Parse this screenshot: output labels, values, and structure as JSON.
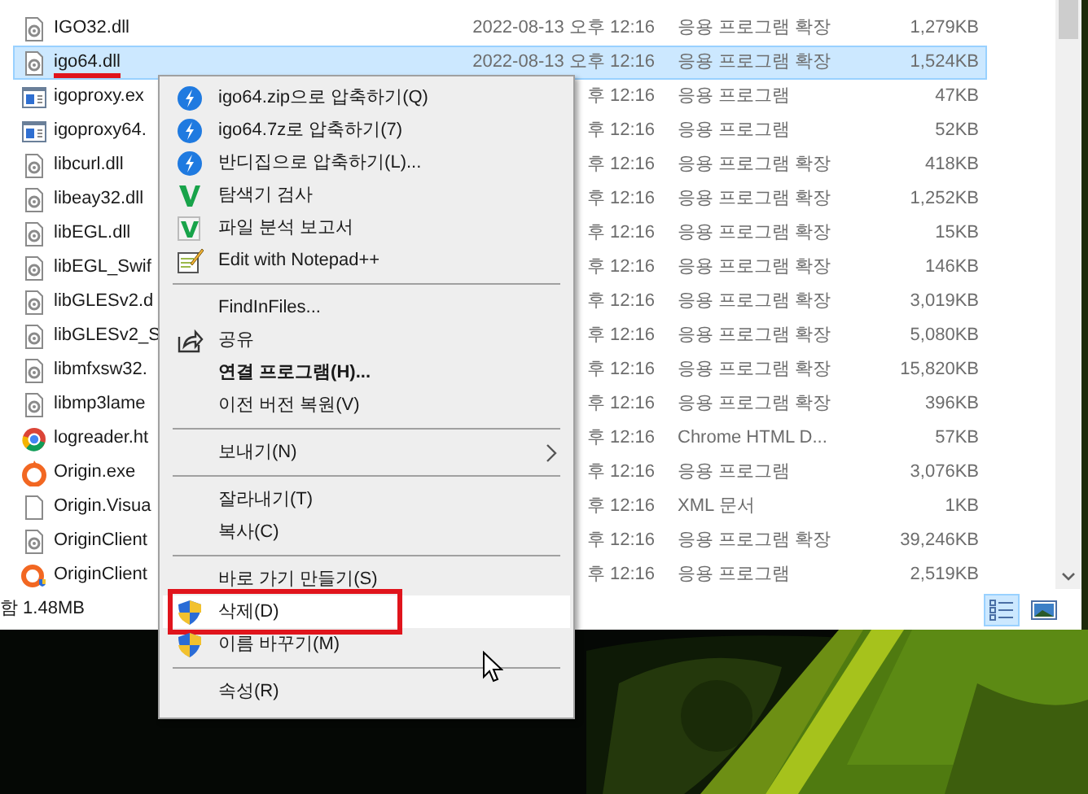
{
  "files": [
    {
      "kind": "dll",
      "name": "IGO32.dll",
      "date": "2022-08-13 오후 12:16",
      "type": "응용 프로그램 확장",
      "size": "1,279KB",
      "selected": false,
      "underlined": false
    },
    {
      "kind": "dll",
      "name": "igo64.dll",
      "date": "2022-08-13 오후 12:16",
      "type": "응용 프로그램 확장",
      "size": "1,524KB",
      "selected": true,
      "underlined": true
    },
    {
      "kind": "exe",
      "name": "igoproxy.ex",
      "date": "후 12:16",
      "type": "응용 프로그램",
      "size": "47KB",
      "selected": false,
      "underlined": false
    },
    {
      "kind": "exe",
      "name": "igoproxy64.",
      "date": "후 12:16",
      "type": "응용 프로그램",
      "size": "52KB",
      "selected": false,
      "underlined": false
    },
    {
      "kind": "dll",
      "name": "libcurl.dll",
      "date": "후 12:16",
      "type": "응용 프로그램 확장",
      "size": "418KB",
      "selected": false,
      "underlined": false
    },
    {
      "kind": "dll",
      "name": "libeay32.dll",
      "date": "후 12:16",
      "type": "응용 프로그램 확장",
      "size": "1,252KB",
      "selected": false,
      "underlined": false
    },
    {
      "kind": "dll",
      "name": "libEGL.dll",
      "date": "후 12:16",
      "type": "응용 프로그램 확장",
      "size": "15KB",
      "selected": false,
      "underlined": false
    },
    {
      "kind": "dll",
      "name": "libEGL_Swif",
      "date": "후 12:16",
      "type": "응용 프로그램 확장",
      "size": "146KB",
      "selected": false,
      "underlined": false
    },
    {
      "kind": "dll",
      "name": "libGLESv2.d",
      "date": "후 12:16",
      "type": "응용 프로그램 확장",
      "size": "3,019KB",
      "selected": false,
      "underlined": false
    },
    {
      "kind": "dll",
      "name": "libGLESv2_S",
      "date": "후 12:16",
      "type": "응용 프로그램 확장",
      "size": "5,080KB",
      "selected": false,
      "underlined": false
    },
    {
      "kind": "dll",
      "name": "libmfxsw32.",
      "date": "후 12:16",
      "type": "응용 프로그램 확장",
      "size": "15,820KB",
      "selected": false,
      "underlined": false
    },
    {
      "kind": "dll",
      "name": "libmp3lame",
      "date": "후 12:16",
      "type": "응용 프로그램 확장",
      "size": "396KB",
      "selected": false,
      "underlined": false
    },
    {
      "kind": "browser",
      "name": "logreader.ht",
      "date": "후 12:16",
      "type": "Chrome HTML D...",
      "size": "57KB",
      "selected": false,
      "underlined": false
    },
    {
      "kind": "origin",
      "name": "Origin.exe",
      "date": "후 12:16",
      "type": "응용 프로그램",
      "size": "3,076KB",
      "selected": false,
      "underlined": false
    },
    {
      "kind": "file",
      "name": "Origin.Visua",
      "date": "후 12:16",
      "type": "XML 문서",
      "size": "1KB",
      "selected": false,
      "underlined": false
    },
    {
      "kind": "dll",
      "name": "OriginClient",
      "date": "후 12:16",
      "type": "응용 프로그램 확장",
      "size": "39,246KB",
      "selected": false,
      "underlined": false
    },
    {
      "kind": "origin-shield",
      "name": "OriginClient",
      "date": "후 12:16",
      "type": "응용 프로그램",
      "size": "2,519KB",
      "selected": false,
      "underlined": false
    }
  ],
  "status_bar": {
    "text": "함 1.48MB",
    "views": [
      {
        "kind": "details",
        "selected": true
      },
      {
        "kind": "preview",
        "selected": false
      }
    ]
  },
  "context_menu": [
    {
      "kind": "archive",
      "label": "igo64.zip으로 압축하기(Q)",
      "bold": false,
      "highlighted": false,
      "submenu": false,
      "boxed": false
    },
    {
      "kind": "archive",
      "label": "igo64.7z로 압축하기(7)",
      "bold": false,
      "highlighted": false,
      "submenu": false,
      "boxed": false
    },
    {
      "kind": "archive",
      "label": "반디집으로 압축하기(L)...",
      "bold": false,
      "highlighted": false,
      "submenu": false,
      "boxed": false
    },
    {
      "kind": "scan",
      "label": "탐색기 검사",
      "bold": false,
      "highlighted": false,
      "submenu": false,
      "boxed": false
    },
    {
      "kind": "report",
      "label": "파일 분석 보고서",
      "bold": false,
      "highlighted": false,
      "submenu": false,
      "boxed": false
    },
    {
      "kind": "notepad",
      "label": "Edit with Notepad++",
      "bold": false,
      "highlighted": false,
      "submenu": false,
      "boxed": false
    },
    {
      "kind": "separator"
    },
    {
      "kind": "plain",
      "label": "FindInFiles...",
      "bold": false,
      "highlighted": false,
      "submenu": false,
      "boxed": false
    },
    {
      "kind": "share",
      "label": "공유",
      "bold": false,
      "highlighted": false,
      "submenu": false,
      "boxed": false
    },
    {
      "kind": "plain",
      "label": "연결 프로그램(H)...",
      "bold": true,
      "highlighted": false,
      "submenu": false,
      "boxed": false
    },
    {
      "kind": "plain",
      "label": "이전 버전 복원(V)",
      "bold": false,
      "highlighted": false,
      "submenu": false,
      "boxed": false
    },
    {
      "kind": "separator"
    },
    {
      "kind": "plain",
      "label": "보내기(N)",
      "bold": false,
      "highlighted": false,
      "submenu": true,
      "boxed": false
    },
    {
      "kind": "separator"
    },
    {
      "kind": "plain",
      "label": "잘라내기(T)",
      "bold": false,
      "highlighted": false,
      "submenu": false,
      "boxed": false
    },
    {
      "kind": "plain",
      "label": "복사(C)",
      "bold": false,
      "highlighted": false,
      "submenu": false,
      "boxed": false
    },
    {
      "kind": "separator"
    },
    {
      "kind": "plain",
      "label": "바로 가기 만들기(S)",
      "bold": false,
      "highlighted": false,
      "submenu": false,
      "boxed": false
    },
    {
      "kind": "shield",
      "label": "삭제(D)",
      "bold": false,
      "highlighted": true,
      "submenu": false,
      "boxed": true
    },
    {
      "kind": "shield",
      "label": "이름 바꾸기(M)",
      "bold": false,
      "highlighted": false,
      "submenu": false,
      "boxed": false
    },
    {
      "kind": "separator"
    },
    {
      "kind": "plain",
      "label": "속성(R)",
      "bold": false,
      "highlighted": false,
      "submenu": false,
      "boxed": false
    }
  ]
}
